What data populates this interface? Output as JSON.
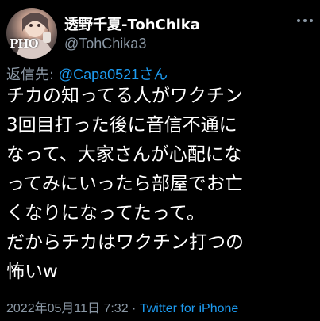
{
  "user": {
    "display_name": "透野千夏-TohChika",
    "handle": "@TohChika3",
    "avatar_text": "PHO"
  },
  "reply": {
    "prefix": "返信先: ",
    "user": "@Capa0521",
    "suffix": "さん"
  },
  "tweet": {
    "lines": [
      "チカの知ってる人がワクチン",
      "3回目打った後に音信不通に",
      "なって、大家さんが心配にな",
      "ってみにいったら部屋でお亡",
      "くなりになってたって。",
      "だからチカはワクチン打つの",
      "怖いw"
    ]
  },
  "meta": {
    "timestamp": "2022年05月11日 7:32",
    "separator": " · ",
    "source": "Twitter for iPhone"
  },
  "colors": {
    "background": "#000000",
    "text": "#ffffff",
    "muted": "#8b98a5",
    "link": "#1d9bf0"
  },
  "icons": {
    "more": "more-dots-icon"
  }
}
